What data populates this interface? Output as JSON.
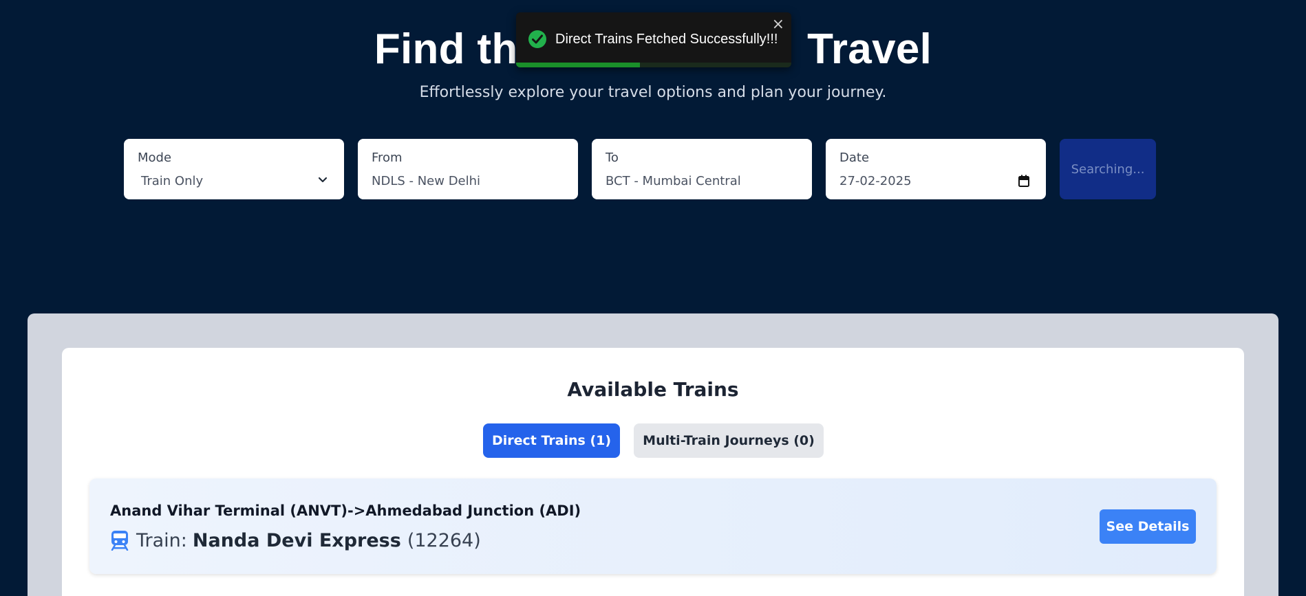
{
  "hero": {
    "title": "Find th                        Travel",
    "subtitle": "Effortlessly explore your travel options and plan your journey."
  },
  "toast": {
    "message": "Direct Trains Fetched Successfully!!!",
    "close_icon": "×",
    "progress": 0.45,
    "status_color": "#22b14c"
  },
  "search": {
    "mode": {
      "label": "Mode",
      "value": "Train Only"
    },
    "from": {
      "label": "From",
      "value": "NDLS - New Delhi"
    },
    "to": {
      "label": "To",
      "value": "BCT - Mumbai Central"
    },
    "date": {
      "label": "Date",
      "value": "27-02-2025"
    },
    "button_label": "Searching..."
  },
  "results": {
    "title": "Available Trains",
    "tabs": [
      {
        "label": "Direct Trains (1)",
        "active": true
      },
      {
        "label": "Multi-Train Journeys (0)",
        "active": false
      }
    ],
    "trains": [
      {
        "route": "Anand Vihar Terminal (ANVT)->Ahmedabad Junction (ADI)",
        "train_prefix": "Train:",
        "name": "Nanda Devi Express",
        "number": "(12264)",
        "icon": "train-icon",
        "details_label": "See Details"
      }
    ]
  },
  "colors": {
    "background": "#021a36",
    "accent": "#2563eb",
    "details_button": "#3b82f6"
  }
}
